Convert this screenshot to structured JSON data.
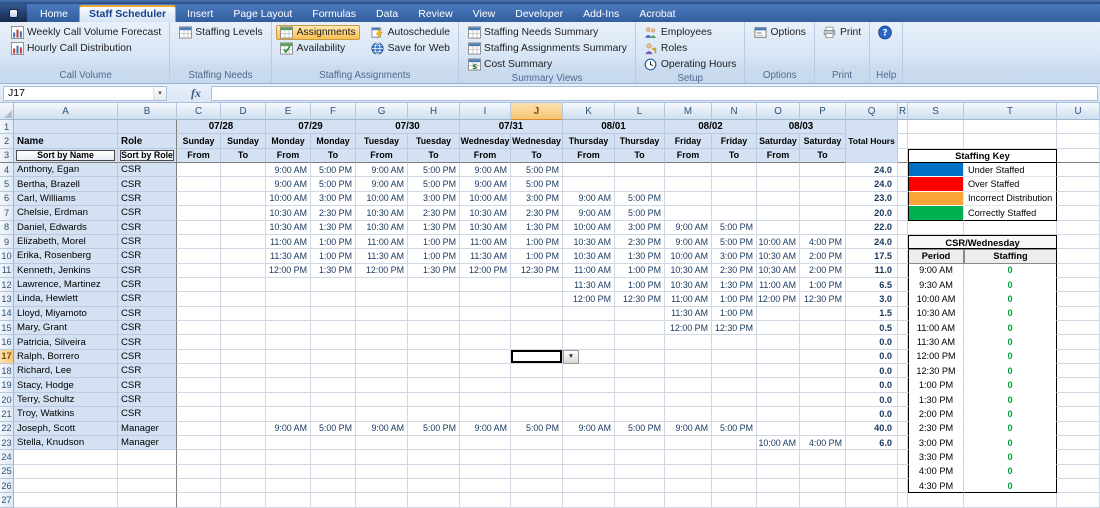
{
  "ribbon": {
    "tabs": [
      "Home",
      "Staff Scheduler",
      "Insert",
      "Page Layout",
      "Formulas",
      "Data",
      "Review",
      "View",
      "Developer",
      "Add-Ins",
      "Acrobat"
    ],
    "active_tab": "Staff Scheduler",
    "groups": [
      {
        "label": "Call Volume",
        "columns": [
          [
            {
              "label": "Weekly Call Volume Forecast",
              "icon": "forecast-chart-icon"
            },
            {
              "label": "Hourly Call Distribution",
              "icon": "distribution-chart-icon"
            }
          ]
        ]
      },
      {
        "label": "Staffing Needs",
        "columns": [
          [
            {
              "label": "Staffing Levels",
              "icon": "staffing-levels-icon"
            }
          ]
        ]
      },
      {
        "label": "Staffing Assignments",
        "columns": [
          [
            {
              "label": "Assignments",
              "icon": "assignments-table-icon",
              "highlighted": true
            },
            {
              "label": "Availability",
              "icon": "availability-table-icon"
            }
          ],
          [
            {
              "label": "Autoschedule",
              "icon": "autoschedule-icon"
            },
            {
              "label": "Save for Web",
              "icon": "save-for-web-icon"
            }
          ]
        ]
      },
      {
        "label": "Summary Views",
        "columns": [
          [
            {
              "label": "Staffing Needs Summary",
              "icon": "summary-table-icon"
            },
            {
              "label": "Staffing Assignments Summary",
              "icon": "summary-table-icon"
            },
            {
              "label": "Cost Summary",
              "icon": "cost-summary-icon"
            }
          ]
        ]
      },
      {
        "label": "Setup",
        "columns": [
          [
            {
              "label": "Employees",
              "icon": "employees-icon"
            },
            {
              "label": "Roles",
              "icon": "roles-icon"
            },
            {
              "label": "Operating Hours",
              "icon": "operating-hours-icon"
            }
          ]
        ]
      },
      {
        "label": "Options",
        "columns": [
          [
            {
              "label": "Options",
              "icon": "options-icon"
            }
          ]
        ]
      },
      {
        "label": "Print",
        "columns": [
          [
            {
              "label": "Print",
              "icon": "print-icon"
            }
          ]
        ]
      },
      {
        "label": "Help",
        "columns": [
          [
            {
              "label": "",
              "icon": "help-icon"
            }
          ]
        ]
      }
    ]
  },
  "formula_bar": {
    "name_box": "J17",
    "fx_label": "fx",
    "formula_value": ""
  },
  "grid": {
    "column_headers": [
      "A",
      "B",
      "C",
      "D",
      "E",
      "F",
      "G",
      "H",
      "I",
      "J",
      "K",
      "L",
      "M",
      "N",
      "O",
      "P",
      "Q",
      "R",
      "S",
      "T",
      "U"
    ],
    "highlighted_column": "J",
    "highlighted_row": 17,
    "selected_cell": "J17",
    "visible_row_count": 27
  },
  "schedule": {
    "name_header": "Name",
    "role_header": "Role",
    "sort_by_name": "Sort by Name",
    "sort_by_role": "Sort by Role",
    "from_label": "From",
    "to_label": "To",
    "total_hours_label": "Total Hours",
    "date_headers": [
      {
        "date": "07/28",
        "day": "Sunday"
      },
      {
        "date": "07/29",
        "day": "Monday"
      },
      {
        "date": "07/30",
        "day": "Tuesday"
      },
      {
        "date": "07/31",
        "day": "Wednesday"
      },
      {
        "date": "08/01",
        "day": "Thursday"
      },
      {
        "date": "08/02",
        "day": "Friday"
      },
      {
        "date": "08/03",
        "day": "Saturday"
      }
    ],
    "employees": [
      {
        "name": "Anthony, Egan",
        "role": "CSR",
        "times": [
          "",
          "",
          "9:00 AM",
          "5:00 PM",
          "9:00 AM",
          "5:00 PM",
          "9:00 AM",
          "5:00 PM",
          "",
          "",
          "",
          "",
          "",
          ""
        ],
        "total": "24.0"
      },
      {
        "name": "Bertha, Brazell",
        "role": "CSR",
        "times": [
          "",
          "",
          "9:00 AM",
          "5:00 PM",
          "9:00 AM",
          "5:00 PM",
          "9:00 AM",
          "5:00 PM",
          "",
          "",
          "",
          "",
          "",
          ""
        ],
        "total": "24.0"
      },
      {
        "name": "Carl, Williams",
        "role": "CSR",
        "times": [
          "",
          "",
          "10:00 AM",
          "3:00 PM",
          "10:00 AM",
          "3:00 PM",
          "10:00 AM",
          "3:00 PM",
          "9:00 AM",
          "5:00 PM",
          "",
          "",
          "",
          ""
        ],
        "total": "23.0"
      },
      {
        "name": "Chelsie, Erdman",
        "role": "CSR",
        "times": [
          "",
          "",
          "10:30 AM",
          "2:30 PM",
          "10:30 AM",
          "2:30 PM",
          "10:30 AM",
          "2:30 PM",
          "9:00 AM",
          "5:00 PM",
          "",
          "",
          "",
          ""
        ],
        "total": "20.0"
      },
      {
        "name": "Daniel, Edwards",
        "role": "CSR",
        "times": [
          "",
          "",
          "10:30 AM",
          "1:30 PM",
          "10:30 AM",
          "1:30 PM",
          "10:30 AM",
          "1:30 PM",
          "10:00 AM",
          "3:00 PM",
          "9:00 AM",
          "5:00 PM",
          "",
          ""
        ],
        "total": "22.0"
      },
      {
        "name": "Elizabeth, Morel",
        "role": "CSR",
        "times": [
          "",
          "",
          "11:00 AM",
          "1:00 PM",
          "11:00 AM",
          "1:00 PM",
          "11:00 AM",
          "1:00 PM",
          "10:30 AM",
          "2:30 PM",
          "9:00 AM",
          "5:00 PM",
          "10:00 AM",
          "4:00 PM"
        ],
        "total": "24.0"
      },
      {
        "name": "Erika, Rosenberg",
        "role": "CSR",
        "times": [
          "",
          "",
          "11:30 AM",
          "1:00 PM",
          "11:30 AM",
          "1:00 PM",
          "11:30 AM",
          "1:00 PM",
          "10:30 AM",
          "1:30 PM",
          "10:00 AM",
          "3:00 PM",
          "10:30 AM",
          "2:00 PM"
        ],
        "total": "17.5"
      },
      {
        "name": "Kenneth, Jenkins",
        "role": "CSR",
        "times": [
          "",
          "",
          "12:00 PM",
          "1:30 PM",
          "12:00 PM",
          "1:30 PM",
          "12:00 PM",
          "12:30 PM",
          "11:00 AM",
          "1:00 PM",
          "10:30 AM",
          "2:30 PM",
          "10:30 AM",
          "2:00 PM"
        ],
        "total": "11.0"
      },
      {
        "name": "Lawrence, Martinez",
        "role": "CSR",
        "times": [
          "",
          "",
          "",
          "",
          "",
          "",
          "",
          "",
          "11:30 AM",
          "1:00 PM",
          "10:30 AM",
          "1:30 PM",
          "11:00 AM",
          "1:00 PM"
        ],
        "total": "6.5"
      },
      {
        "name": "Linda, Hewlett",
        "role": "CSR",
        "times": [
          "",
          "",
          "",
          "",
          "",
          "",
          "",
          "",
          "12:00 PM",
          "12:30 PM",
          "11:00 AM",
          "1:00 PM",
          "12:00 PM",
          "12:30 PM"
        ],
        "total": "3.0"
      },
      {
        "name": "Lloyd, Miyamoto",
        "role": "CSR",
        "times": [
          "",
          "",
          "",
          "",
          "",
          "",
          "",
          "",
          "",
          "",
          "11:30 AM",
          "1:00 PM",
          "",
          ""
        ],
        "total": "1.5"
      },
      {
        "name": "Mary, Grant",
        "role": "CSR",
        "times": [
          "",
          "",
          "",
          "",
          "",
          "",
          "",
          "",
          "",
          "",
          "12:00 PM",
          "12:30 PM",
          "",
          ""
        ],
        "total": "0.5"
      },
      {
        "name": "Patricia, Silveira",
        "role": "CSR",
        "times": [
          "",
          "",
          "",
          "",
          "",
          "",
          "",
          "",
          "",
          "",
          "",
          "",
          "",
          ""
        ],
        "total": "0.0"
      },
      {
        "name": "Ralph, Borrero",
        "role": "CSR",
        "times": [
          "",
          "",
          "",
          "",
          "",
          "",
          "",
          "",
          "",
          "",
          "",
          "",
          "",
          ""
        ],
        "total": "0.0"
      },
      {
        "name": "Richard, Lee",
        "role": "CSR",
        "times": [
          "",
          "",
          "",
          "",
          "",
          "",
          "",
          "",
          "",
          "",
          "",
          "",
          "",
          ""
        ],
        "total": "0.0"
      },
      {
        "name": "Stacy, Hodge",
        "role": "CSR",
        "times": [
          "",
          "",
          "",
          "",
          "",
          "",
          "",
          "",
          "",
          "",
          "",
          "",
          "",
          ""
        ],
        "total": "0.0"
      },
      {
        "name": "Terry, Schultz",
        "role": "CSR",
        "times": [
          "",
          "",
          "",
          "",
          "",
          "",
          "",
          "",
          "",
          "",
          "",
          "",
          "",
          ""
        ],
        "total": "0.0"
      },
      {
        "name": "Troy, Watkins",
        "role": "CSR",
        "times": [
          "",
          "",
          "",
          "",
          "",
          "",
          "",
          "",
          "",
          "",
          "",
          "",
          "",
          ""
        ],
        "total": "0.0"
      },
      {
        "name": "Joseph, Scott",
        "role": "Manager",
        "times": [
          "",
          "",
          "9:00 AM",
          "5:00 PM",
          "9:00 AM",
          "5:00 PM",
          "9:00 AM",
          "5:00 PM",
          "9:00 AM",
          "5:00 PM",
          "9:00 AM",
          "5:00 PM",
          "",
          ""
        ],
        "total": "40.0"
      },
      {
        "name": "Stella, Knudson",
        "role": "Manager",
        "times": [
          "",
          "",
          "",
          "",
          "",
          "",
          "",
          "",
          "",
          "",
          "",
          "",
          "10:00 AM",
          "4:00 PM"
        ],
        "total": "6.0"
      }
    ]
  },
  "staffing_key": {
    "title": "Staffing Key",
    "entries": [
      {
        "label": "Under Staffed",
        "color": "#0070C6"
      },
      {
        "label": "Over Staffed",
        "color": "#FE0000"
      },
      {
        "label": "Incorrect Distribution",
        "color": "#FAA43A"
      },
      {
        "label": "Correctly Staffed",
        "color": "#00B050"
      }
    ]
  },
  "staffing_detail": {
    "title": "CSR/Wednesday",
    "period_header": "Period",
    "staffing_header": "Staffing",
    "rows": [
      {
        "period": "9:00 AM",
        "staffing": "0"
      },
      {
        "period": "9:30 AM",
        "staffing": "0"
      },
      {
        "period": "10:00 AM",
        "staffing": "0"
      },
      {
        "period": "10:30 AM",
        "staffing": "0"
      },
      {
        "period": "11:00 AM",
        "staffing": "0"
      },
      {
        "period": "11:30 AM",
        "staffing": "0"
      },
      {
        "period": "12:00 PM",
        "staffing": "0"
      },
      {
        "period": "12:30 PM",
        "staffing": "0"
      },
      {
        "period": "1:00 PM",
        "staffing": "0"
      },
      {
        "period": "1:30 PM",
        "staffing": "0"
      },
      {
        "period": "2:00 PM",
        "staffing": "0"
      },
      {
        "period": "2:30 PM",
        "staffing": "0"
      },
      {
        "period": "3:00 PM",
        "staffing": "0"
      },
      {
        "period": "3:30 PM",
        "staffing": "0"
      },
      {
        "period": "4:00 PM",
        "staffing": "0"
      },
      {
        "period": "4:30 PM",
        "staffing": "0"
      }
    ]
  }
}
